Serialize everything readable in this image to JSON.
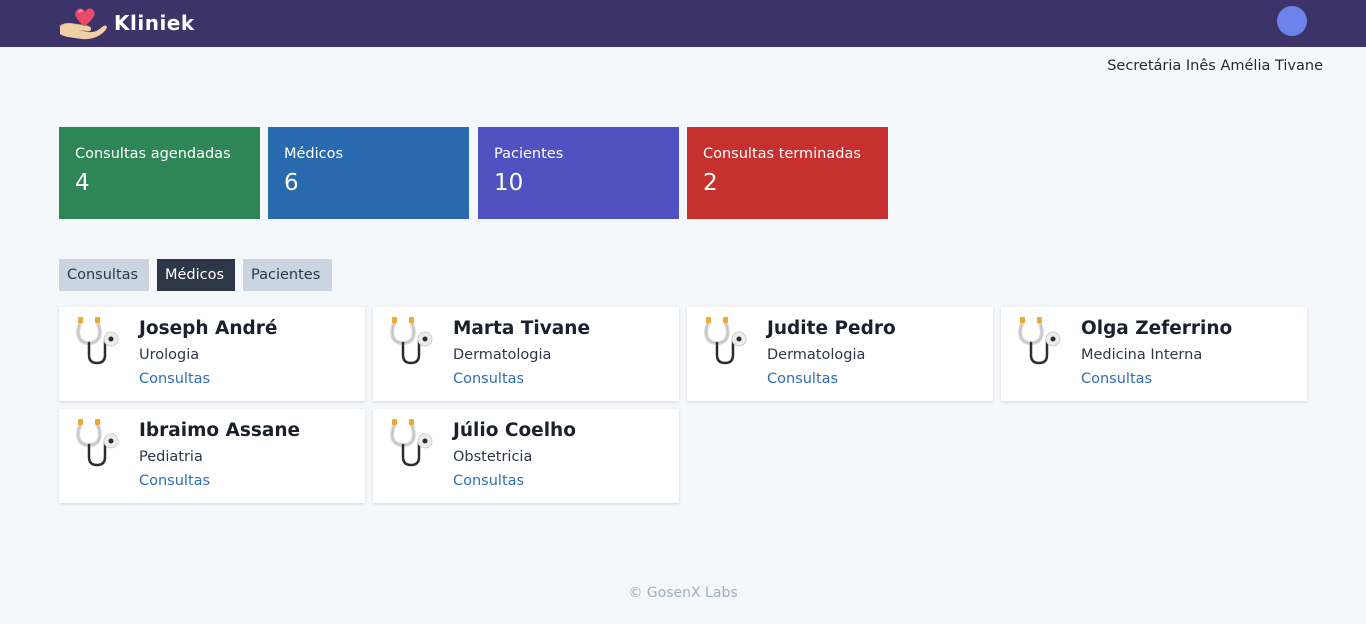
{
  "header": {
    "brand_name": "Kliniek",
    "brand_logo_icon": "heart-hand-icon",
    "avatar_color": "#6d83ec",
    "bar_color": "#3c3468"
  },
  "user": {
    "name": "Secretária Inês Amélia Tivane"
  },
  "stats": [
    {
      "label": "Consultas agendadas",
      "value": "4",
      "color": "#2e8555"
    },
    {
      "label": "Médicos",
      "value": "6",
      "color": "#2a6bb0"
    },
    {
      "label": "Pacientes",
      "value": "10",
      "color": "#4f52c0"
    },
    {
      "label": "Consultas terminadas",
      "value": "2",
      "color": "#c6302f"
    }
  ],
  "tabs": [
    {
      "label": "Consultas",
      "active": false
    },
    {
      "label": "Médicos",
      "active": true
    },
    {
      "label": "Pacientes",
      "active": false
    }
  ],
  "doctors": [
    {
      "name": "Joseph André",
      "specialty": "Urologia",
      "link": "Consultas",
      "icon": "stethoscope-icon"
    },
    {
      "name": "Marta Tivane",
      "specialty": "Dermatologia",
      "link": "Consultas",
      "icon": "stethoscope-icon"
    },
    {
      "name": "Judite Pedro",
      "specialty": "Dermatologia",
      "link": "Consultas",
      "icon": "stethoscope-icon"
    },
    {
      "name": "Olga Zeferrino",
      "specialty": "Medicina Interna",
      "link": "Consultas",
      "icon": "stethoscope-icon"
    },
    {
      "name": "Ibraimo Assane",
      "specialty": "Pediatria",
      "link": "Consultas",
      "icon": "stethoscope-icon"
    },
    {
      "name": "Júlio Coelho",
      "specialty": "Obstetricia",
      "link": "Consultas",
      "icon": "stethoscope-icon"
    }
  ],
  "footer": {
    "text": "© GosenX Labs"
  }
}
